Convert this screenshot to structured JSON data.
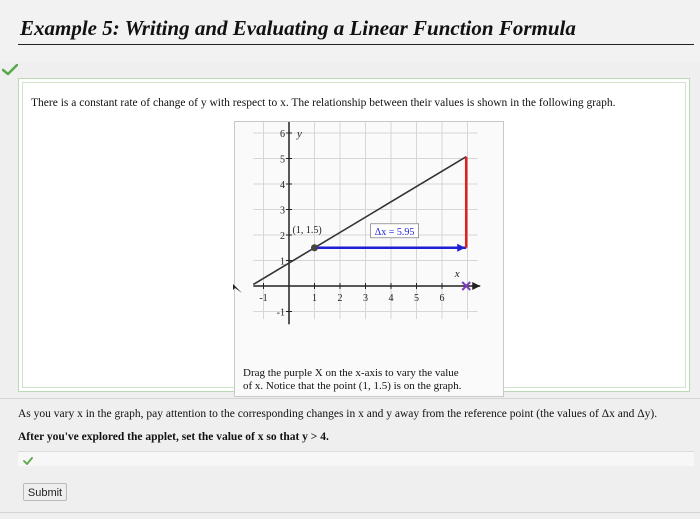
{
  "header": {
    "title": "Example 5: Writing and Evaluating a Linear Function Formula"
  },
  "panel": {
    "intro_text": "There is a constant rate of change of y with respect to x. The relationship between their values is shown in the following graph.",
    "caption_line1": "Drag the purple X on the x-axis to vary the value",
    "caption_line2": "of x. Notice that the point (1, 1.5) is on the graph."
  },
  "graph": {
    "y_axis_label": "y",
    "x_axis_label": "x",
    "point_label": "(1, 1.5)",
    "delta_label": "Δx = 5.95",
    "x_tick_labels": [
      "-1",
      "1",
      "2",
      "3",
      "4",
      "5",
      "6"
    ],
    "y_tick_labels": [
      "-1",
      "1",
      "2",
      "3",
      "4",
      "5",
      "6"
    ],
    "line_color": "#333333",
    "delta_x_color": "#1f1fd6",
    "delta_y_color": "#e02020",
    "point_color": "#444444",
    "reference_point": {
      "x": 1,
      "y": 1.5
    },
    "current_x": 6.95,
    "slope": 0.6
  },
  "instructions": {
    "line1": "As you vary x in the graph, pay attention to the corresponding changes in x and y away from the reference point (the values of Δx and Δy).",
    "line2": "After you've explored the applet, set the value of x so that y > 4."
  },
  "submit": {
    "label": "Submit"
  },
  "colors": {
    "check": "#5aa74a",
    "panel_border": "#bcd9b6"
  },
  "icons": {
    "top_check": "check-icon",
    "answer_check": "check-icon",
    "cursor": "cursor-arrow-icon"
  }
}
